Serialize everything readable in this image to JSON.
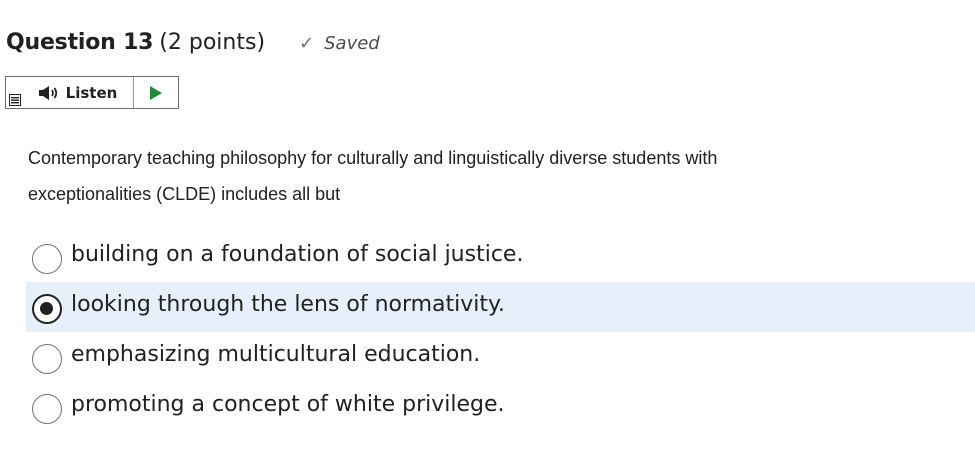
{
  "question": {
    "title": "Question 13",
    "points": "(2 points)",
    "status": "Saved",
    "status_icon": "checkmark-icon"
  },
  "listen_widget": {
    "menu_icon": "menu-icon",
    "speaker_icon": "speaker-icon",
    "label": "Listen",
    "play_icon": "play-icon",
    "play_color": "#1e8a3a"
  },
  "prompt": {
    "line1": "Contemporary teaching philosophy for culturally and linguistically diverse students with",
    "line2": "exceptionalities (CLDE) includes all but"
  },
  "options": [
    {
      "label": "building on a foundation of social justice.",
      "selected": false
    },
    {
      "label": "looking through the lens of normativity.",
      "selected": true
    },
    {
      "label": "emphasizing multicultural education.",
      "selected": false
    },
    {
      "label": "promoting a concept of white privilege.",
      "selected": false
    }
  ],
  "colors": {
    "selected_background": "#e7f0fa",
    "text": "#202122"
  }
}
